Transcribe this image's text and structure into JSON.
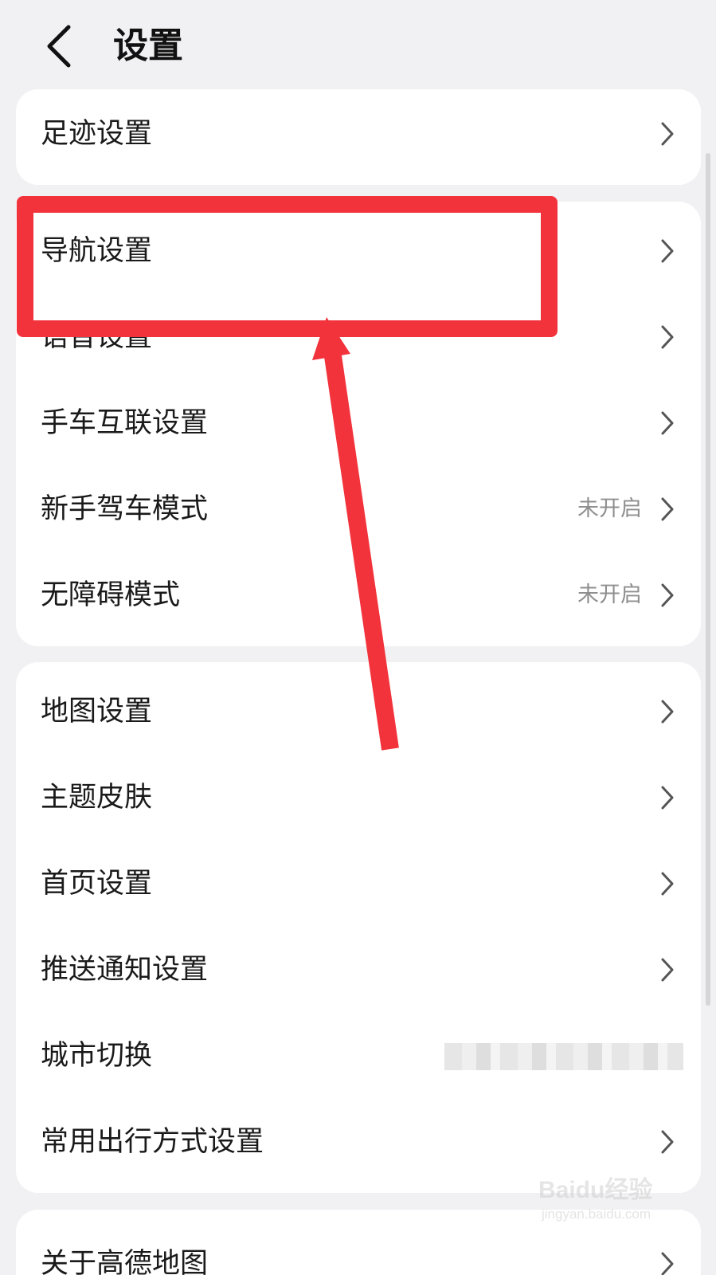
{
  "header": {
    "title": "设置",
    "back_icon": "chevron-left-icon"
  },
  "card1": {
    "items": [
      {
        "label": "足迹设置"
      }
    ]
  },
  "card2": {
    "items": [
      {
        "label": "导航设置",
        "value": ""
      },
      {
        "label": "语音设置",
        "value": ""
      },
      {
        "label": "手车互联设置",
        "value": ""
      },
      {
        "label": "新手驾车模式",
        "value": "未开启"
      },
      {
        "label": "无障碍模式",
        "value": "未开启"
      }
    ]
  },
  "card3": {
    "items": [
      {
        "label": "地图设置"
      },
      {
        "label": "主题皮肤"
      },
      {
        "label": "首页设置"
      },
      {
        "label": "推送通知设置"
      },
      {
        "label": "城市切换",
        "value_blurred": true
      },
      {
        "label": "常用出行方式设置"
      }
    ]
  },
  "card4": {
    "items": [
      {
        "label": "关于高德地图"
      }
    ]
  },
  "annotation": {
    "color": "#f2333c"
  },
  "watermark": {
    "logo": "Baidu经验",
    "url": "jingyan.baidu.com"
  },
  "colors": {
    "background": "#f1f1f3",
    "card": "#ffffff",
    "text": "#1a1a1a",
    "secondary_text": "#8f8f8f",
    "chevron": "#555555"
  }
}
